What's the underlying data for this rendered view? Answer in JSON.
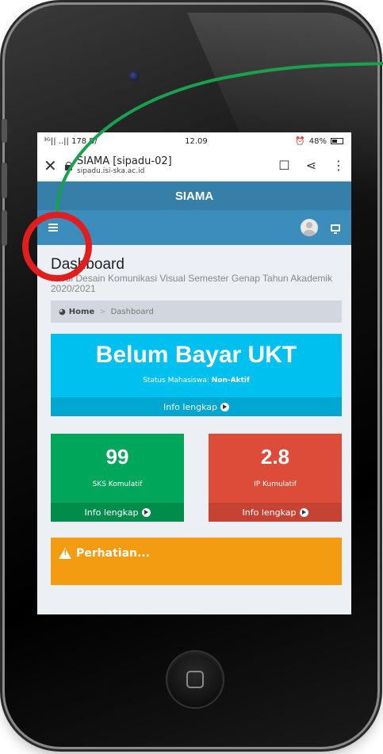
{
  "status_bar": {
    "signal": "³ᴳ|| ..|| 178 B/",
    "time": "12.09",
    "battery": "48%"
  },
  "browser": {
    "title": "SIAMA [sipadu-02]",
    "url": "sipadu.isi-ska.ac.id"
  },
  "app": {
    "brand": "SIAMA"
  },
  "page": {
    "title": "Dashboard",
    "subtitle": "Prodi Desain Komunikasi Visual Semester Genap Tahun Akademik 2020/2021",
    "breadcrumb": {
      "home": "Home",
      "separator": ">",
      "current": "Dashboard"
    }
  },
  "ukt": {
    "headline": "Belum Bayar UKT",
    "status_label": "Status Mahasiswa:",
    "status_value": "Non-Aktif",
    "link": "Info lengkap"
  },
  "stats": [
    {
      "value": "99",
      "label": "SKS Komulatif",
      "link": "Info lengkap",
      "color": "#00a65a"
    },
    {
      "value": "2.8",
      "label": "IP Kumulatif",
      "link": "Info lengkap",
      "color": "#dd4b39"
    }
  ],
  "alert": {
    "title": "Perhatian..."
  },
  "annotation": {
    "circle_color": "#e11d1d",
    "arrow_color": "#1aa150"
  }
}
